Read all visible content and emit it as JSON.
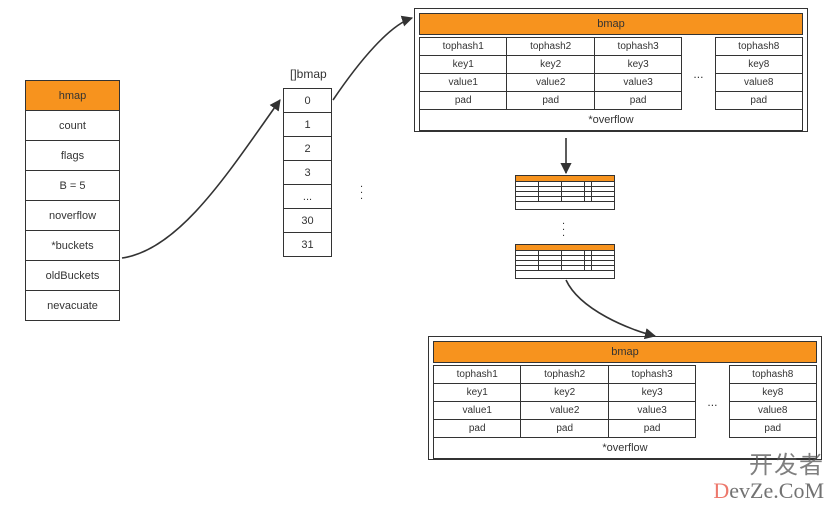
{
  "hmap": {
    "title": "hmap",
    "fields": [
      "count",
      "flags",
      "B = 5",
      "noverflow",
      "*buckets",
      "oldBuckets",
      "nevacuate"
    ]
  },
  "bucket_array": {
    "label": "[]bmap",
    "indices": [
      "0",
      "1",
      "2",
      "3",
      "...",
      "30",
      "31"
    ]
  },
  "bmap_top": {
    "title": "bmap",
    "cols": {
      "tophash": [
        "tophash1",
        "tophash2",
        "tophash3"
      ],
      "key": [
        "key1",
        "key2",
        "key3"
      ],
      "value": [
        "value1",
        "value2",
        "value3"
      ],
      "pad": [
        "pad",
        "pad",
        "pad"
      ],
      "last_tophash": "tophash8",
      "last_key": "key8",
      "last_value": "value8",
      "last_pad": "pad",
      "dots": "..."
    },
    "overflow": "*overflow"
  },
  "bmap_bottom": {
    "title": "bmap",
    "cols": {
      "tophash": [
        "tophash1",
        "tophash2",
        "tophash3"
      ],
      "key": [
        "key1",
        "key2",
        "key3"
      ],
      "value": [
        "value1",
        "value2",
        "value3"
      ],
      "pad": [
        "pad",
        "pad",
        "pad"
      ],
      "last_tophash": "tophash8",
      "last_key": "key8",
      "last_value": "value8",
      "last_pad": "pad",
      "dots": "..."
    },
    "overflow": "*overflow"
  },
  "side_dots": ".",
  "watermark": {
    "line1": "开发者",
    "line2a": "D",
    "line2b": "evZe.CoM"
  }
}
